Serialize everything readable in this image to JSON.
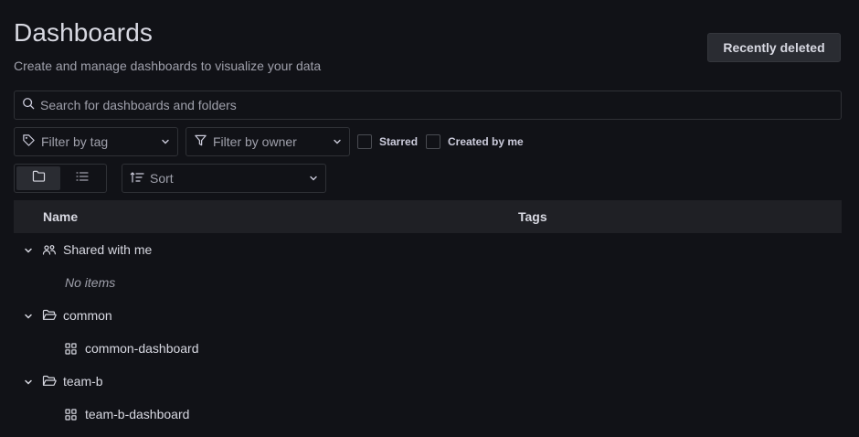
{
  "header": {
    "title": "Dashboards",
    "subtitle": "Create and manage dashboards to visualize your data",
    "recently_deleted_label": "Recently deleted"
  },
  "search": {
    "placeholder": "Search for dashboards and folders",
    "value": ""
  },
  "filters": {
    "tag_label": "Filter by tag",
    "owner_label": "Filter by owner",
    "starred_label": "Starred",
    "created_by_me_label": "Created by me"
  },
  "view": {
    "active": "folder-view",
    "sort_label": "Sort"
  },
  "table": {
    "columns": [
      "Name",
      "Tags"
    ],
    "rows": [
      {
        "type": "folder",
        "name": "Shared with me",
        "icon": "users-icon",
        "expanded": true
      },
      {
        "type": "empty",
        "name": "No items"
      },
      {
        "type": "folder",
        "name": "common",
        "icon": "folder-open-icon",
        "expanded": true
      },
      {
        "type": "dashboard",
        "name": "common-dashboard",
        "icon": "apps-icon"
      },
      {
        "type": "folder",
        "name": "team-b",
        "icon": "folder-open-icon",
        "expanded": true
      },
      {
        "type": "dashboard",
        "name": "team-b-dashboard",
        "icon": "apps-icon"
      }
    ]
  },
  "colors": {
    "background": "#111217",
    "header_row": "#1f2025",
    "text_primary": "#d8d9e2",
    "text_secondary": "#9fa0ab"
  }
}
